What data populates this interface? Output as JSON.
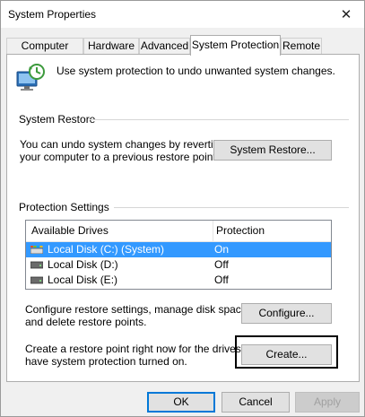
{
  "window": {
    "title": "System Properties"
  },
  "tabs": [
    {
      "label": "Computer Name",
      "active": false
    },
    {
      "label": "Hardware",
      "active": false
    },
    {
      "label": "Advanced",
      "active": false
    },
    {
      "label": "System Protection",
      "active": true
    },
    {
      "label": "Remote",
      "active": false
    }
  ],
  "intro": {
    "text": "Use system protection to undo unwanted system changes."
  },
  "system_restore": {
    "heading": "System Restore",
    "line1": "You can undo system changes by reverting",
    "line2": "your computer to a previous restore point.",
    "button": "System Restore..."
  },
  "protection": {
    "heading": "Protection Settings",
    "columns": [
      "Available Drives",
      "Protection"
    ],
    "drives": [
      {
        "name": "Local Disk (C:) (System)",
        "protection": "On",
        "selected": true,
        "icon": "system-drive-icon"
      },
      {
        "name": "Local Disk (D:)",
        "protection": "Off",
        "selected": false,
        "icon": "hard-drive-icon"
      },
      {
        "name": "Local Disk (E:)",
        "protection": "Off",
        "selected": false,
        "icon": "hard-drive-icon"
      }
    ],
    "configure": {
      "line1": "Configure restore settings, manage disk space,",
      "line2": "and delete restore points.",
      "button": "Configure..."
    },
    "create": {
      "line1": "Create a restore point right now for the drives that",
      "line2": "have system protection turned on.",
      "button": "Create..."
    }
  },
  "footer": {
    "ok": "OK",
    "cancel": "Cancel",
    "apply": "Apply"
  },
  "colors": {
    "selection": "#3399ff",
    "accent": "#0078d7",
    "highlight_border": "#000000"
  }
}
